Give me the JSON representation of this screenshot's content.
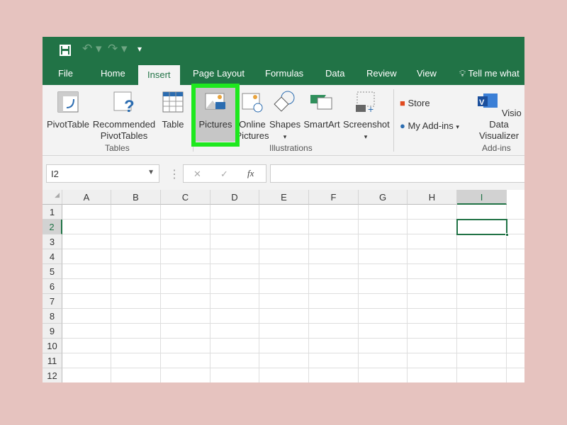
{
  "qat": {
    "save": "save-icon",
    "undo": "undo-icon",
    "redo": "redo-icon",
    "customize": "customize-icon"
  },
  "tabs": [
    "File",
    "Home",
    "Insert",
    "Page Layout",
    "Formulas",
    "Data",
    "Review",
    "View"
  ],
  "tell_me": "Tell me what",
  "ribbon": {
    "pivottable": "PivotTable",
    "recommended1": "Recommended",
    "recommended2": "PivotTables",
    "table": "Table",
    "tables_group": "Tables",
    "pictures": "Pictures",
    "online1": "Online",
    "online2": "Pictures",
    "shapes": "Shapes",
    "smartart": "SmartArt",
    "screenshot": "Screenshot",
    "illustrations_group": "Illustrations",
    "store": "Store",
    "my_addins": "My Add-ins",
    "visio1": "Visio Data",
    "visio2": "Visualizer",
    "addins_group": "Add-ins"
  },
  "formula_bar": {
    "name_box": "I2",
    "cancel": "✕",
    "enter": "✓",
    "fx": "fx",
    "value": ""
  },
  "columns": [
    "A",
    "B",
    "C",
    "D",
    "E",
    "F",
    "G",
    "H",
    "I"
  ],
  "rows": [
    "1",
    "2",
    "3",
    "4",
    "5",
    "6",
    "7",
    "8",
    "9",
    "10",
    "11",
    "12"
  ],
  "selected_cell": "I2",
  "colors": {
    "accent": "#217346",
    "highlight": "#1ee81e"
  }
}
